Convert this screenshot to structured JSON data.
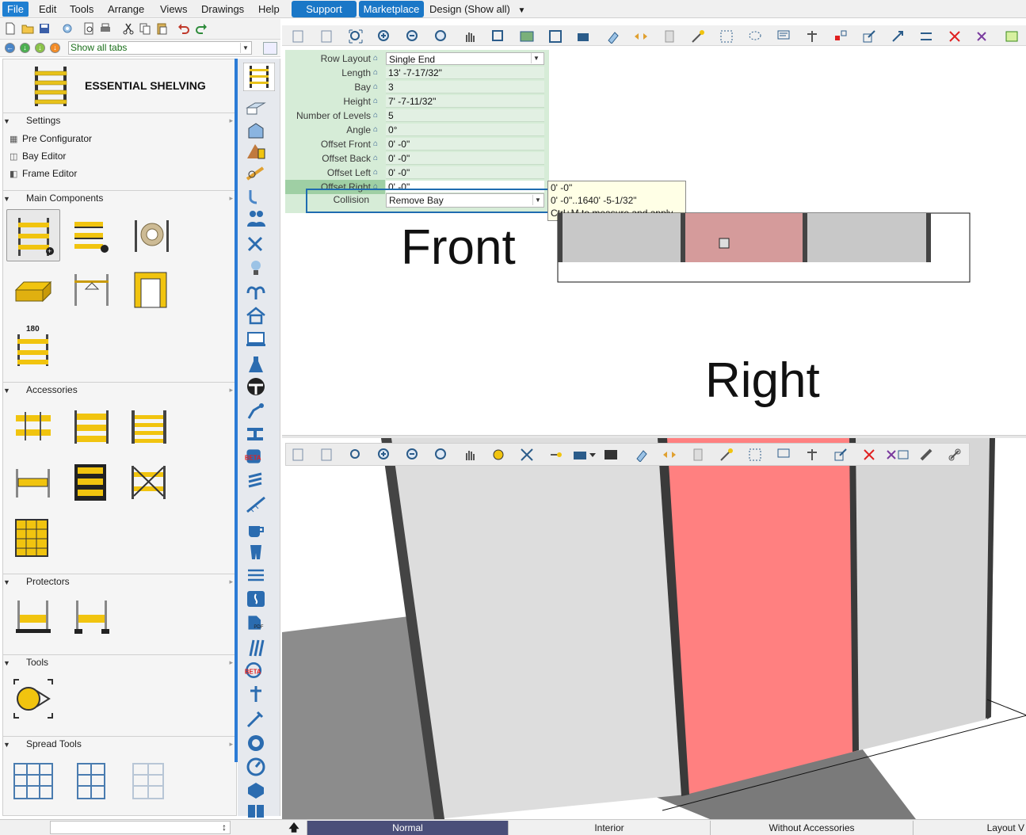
{
  "menubar": {
    "items": [
      "File",
      "Edit",
      "Tools",
      "Arrange",
      "Views",
      "Drawings",
      "Help"
    ],
    "buttons": [
      "Support",
      "Marketplace"
    ],
    "mode": "Design (Show all)"
  },
  "tabs_filter": {
    "value": "Show all tabs"
  },
  "left_panel": {
    "title": "ESSENTIAL SHELVING",
    "sections": {
      "settings": "Settings",
      "main_components": "Main Components",
      "accessories": "Accessories",
      "protectors": "Protectors",
      "tools": "Tools",
      "spread_tools": "Spread Tools"
    },
    "settings_items": [
      "Pre Configurator",
      "Bay Editor",
      "Frame Editor"
    ]
  },
  "properties": {
    "rows": [
      {
        "label": "Row Layout",
        "value": "Single End"
      },
      {
        "label": "Length",
        "value": "13' -7-17/32\""
      },
      {
        "label": "Bay",
        "value": "3"
      },
      {
        "label": "Height",
        "value": "7' -7-11/32\""
      },
      {
        "label": "Number of Levels",
        "value": "5"
      },
      {
        "label": "Angle",
        "value": "0°"
      },
      {
        "label": "Offset Front",
        "value": "0' -0\""
      },
      {
        "label": "Offset Back",
        "value": "0' -0\""
      },
      {
        "label": "Offset Left",
        "value": "0' -0\""
      },
      {
        "label": "Offset Right",
        "value": "0' -0\""
      }
    ],
    "collision": {
      "label": "Collision",
      "value": "Remove Bay"
    }
  },
  "tooltip": {
    "line1": "0' -0\"",
    "line2": "0' -0\"..1640' -5-1/32\"",
    "line3": "Ctrl+M to measure and apply"
  },
  "view2d": {
    "label_front": "Front",
    "label_right": "Right"
  },
  "status_bar": {
    "tabs": [
      "Normal",
      "Interior",
      "Without Accessories",
      "Layout V"
    ],
    "active": "Normal"
  },
  "colors": {
    "accent": "#1a77c7",
    "props_bg": "#d6ecd7",
    "selected_bay": "#d59b9b",
    "bay_grey": "#c8c8c8",
    "bay3d_red": "#ff8080",
    "status_active": "#4a4f79"
  }
}
